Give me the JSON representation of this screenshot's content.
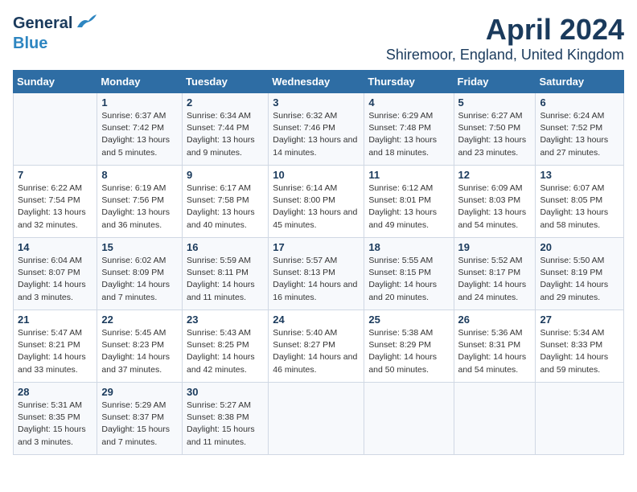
{
  "header": {
    "logo_line1": "General",
    "logo_line2": "Blue",
    "main_title": "April 2024",
    "subtitle": "Shiremoor, England, United Kingdom"
  },
  "weekdays": [
    "Sunday",
    "Monday",
    "Tuesday",
    "Wednesday",
    "Thursday",
    "Friday",
    "Saturday"
  ],
  "weeks": [
    [
      {
        "num": "",
        "sunrise": "",
        "sunset": "",
        "daylight": ""
      },
      {
        "num": "1",
        "sunrise": "Sunrise: 6:37 AM",
        "sunset": "Sunset: 7:42 PM",
        "daylight": "Daylight: 13 hours and 5 minutes."
      },
      {
        "num": "2",
        "sunrise": "Sunrise: 6:34 AM",
        "sunset": "Sunset: 7:44 PM",
        "daylight": "Daylight: 13 hours and 9 minutes."
      },
      {
        "num": "3",
        "sunrise": "Sunrise: 6:32 AM",
        "sunset": "Sunset: 7:46 PM",
        "daylight": "Daylight: 13 hours and 14 minutes."
      },
      {
        "num": "4",
        "sunrise": "Sunrise: 6:29 AM",
        "sunset": "Sunset: 7:48 PM",
        "daylight": "Daylight: 13 hours and 18 minutes."
      },
      {
        "num": "5",
        "sunrise": "Sunrise: 6:27 AM",
        "sunset": "Sunset: 7:50 PM",
        "daylight": "Daylight: 13 hours and 23 minutes."
      },
      {
        "num": "6",
        "sunrise": "Sunrise: 6:24 AM",
        "sunset": "Sunset: 7:52 PM",
        "daylight": "Daylight: 13 hours and 27 minutes."
      }
    ],
    [
      {
        "num": "7",
        "sunrise": "Sunrise: 6:22 AM",
        "sunset": "Sunset: 7:54 PM",
        "daylight": "Daylight: 13 hours and 32 minutes."
      },
      {
        "num": "8",
        "sunrise": "Sunrise: 6:19 AM",
        "sunset": "Sunset: 7:56 PM",
        "daylight": "Daylight: 13 hours and 36 minutes."
      },
      {
        "num": "9",
        "sunrise": "Sunrise: 6:17 AM",
        "sunset": "Sunset: 7:58 PM",
        "daylight": "Daylight: 13 hours and 40 minutes."
      },
      {
        "num": "10",
        "sunrise": "Sunrise: 6:14 AM",
        "sunset": "Sunset: 8:00 PM",
        "daylight": "Daylight: 13 hours and 45 minutes."
      },
      {
        "num": "11",
        "sunrise": "Sunrise: 6:12 AM",
        "sunset": "Sunset: 8:01 PM",
        "daylight": "Daylight: 13 hours and 49 minutes."
      },
      {
        "num": "12",
        "sunrise": "Sunrise: 6:09 AM",
        "sunset": "Sunset: 8:03 PM",
        "daylight": "Daylight: 13 hours and 54 minutes."
      },
      {
        "num": "13",
        "sunrise": "Sunrise: 6:07 AM",
        "sunset": "Sunset: 8:05 PM",
        "daylight": "Daylight: 13 hours and 58 minutes."
      }
    ],
    [
      {
        "num": "14",
        "sunrise": "Sunrise: 6:04 AM",
        "sunset": "Sunset: 8:07 PM",
        "daylight": "Daylight: 14 hours and 3 minutes."
      },
      {
        "num": "15",
        "sunrise": "Sunrise: 6:02 AM",
        "sunset": "Sunset: 8:09 PM",
        "daylight": "Daylight: 14 hours and 7 minutes."
      },
      {
        "num": "16",
        "sunrise": "Sunrise: 5:59 AM",
        "sunset": "Sunset: 8:11 PM",
        "daylight": "Daylight: 14 hours and 11 minutes."
      },
      {
        "num": "17",
        "sunrise": "Sunrise: 5:57 AM",
        "sunset": "Sunset: 8:13 PM",
        "daylight": "Daylight: 14 hours and 16 minutes."
      },
      {
        "num": "18",
        "sunrise": "Sunrise: 5:55 AM",
        "sunset": "Sunset: 8:15 PM",
        "daylight": "Daylight: 14 hours and 20 minutes."
      },
      {
        "num": "19",
        "sunrise": "Sunrise: 5:52 AM",
        "sunset": "Sunset: 8:17 PM",
        "daylight": "Daylight: 14 hours and 24 minutes."
      },
      {
        "num": "20",
        "sunrise": "Sunrise: 5:50 AM",
        "sunset": "Sunset: 8:19 PM",
        "daylight": "Daylight: 14 hours and 29 minutes."
      }
    ],
    [
      {
        "num": "21",
        "sunrise": "Sunrise: 5:47 AM",
        "sunset": "Sunset: 8:21 PM",
        "daylight": "Daylight: 14 hours and 33 minutes."
      },
      {
        "num": "22",
        "sunrise": "Sunrise: 5:45 AM",
        "sunset": "Sunset: 8:23 PM",
        "daylight": "Daylight: 14 hours and 37 minutes."
      },
      {
        "num": "23",
        "sunrise": "Sunrise: 5:43 AM",
        "sunset": "Sunset: 8:25 PM",
        "daylight": "Daylight: 14 hours and 42 minutes."
      },
      {
        "num": "24",
        "sunrise": "Sunrise: 5:40 AM",
        "sunset": "Sunset: 8:27 PM",
        "daylight": "Daylight: 14 hours and 46 minutes."
      },
      {
        "num": "25",
        "sunrise": "Sunrise: 5:38 AM",
        "sunset": "Sunset: 8:29 PM",
        "daylight": "Daylight: 14 hours and 50 minutes."
      },
      {
        "num": "26",
        "sunrise": "Sunrise: 5:36 AM",
        "sunset": "Sunset: 8:31 PM",
        "daylight": "Daylight: 14 hours and 54 minutes."
      },
      {
        "num": "27",
        "sunrise": "Sunrise: 5:34 AM",
        "sunset": "Sunset: 8:33 PM",
        "daylight": "Daylight: 14 hours and 59 minutes."
      }
    ],
    [
      {
        "num": "28",
        "sunrise": "Sunrise: 5:31 AM",
        "sunset": "Sunset: 8:35 PM",
        "daylight": "Daylight: 15 hours and 3 minutes."
      },
      {
        "num": "29",
        "sunrise": "Sunrise: 5:29 AM",
        "sunset": "Sunset: 8:37 PM",
        "daylight": "Daylight: 15 hours and 7 minutes."
      },
      {
        "num": "30",
        "sunrise": "Sunrise: 5:27 AM",
        "sunset": "Sunset: 8:38 PM",
        "daylight": "Daylight: 15 hours and 11 minutes."
      },
      {
        "num": "",
        "sunrise": "",
        "sunset": "",
        "daylight": ""
      },
      {
        "num": "",
        "sunrise": "",
        "sunset": "",
        "daylight": ""
      },
      {
        "num": "",
        "sunrise": "",
        "sunset": "",
        "daylight": ""
      },
      {
        "num": "",
        "sunrise": "",
        "sunset": "",
        "daylight": ""
      }
    ]
  ]
}
